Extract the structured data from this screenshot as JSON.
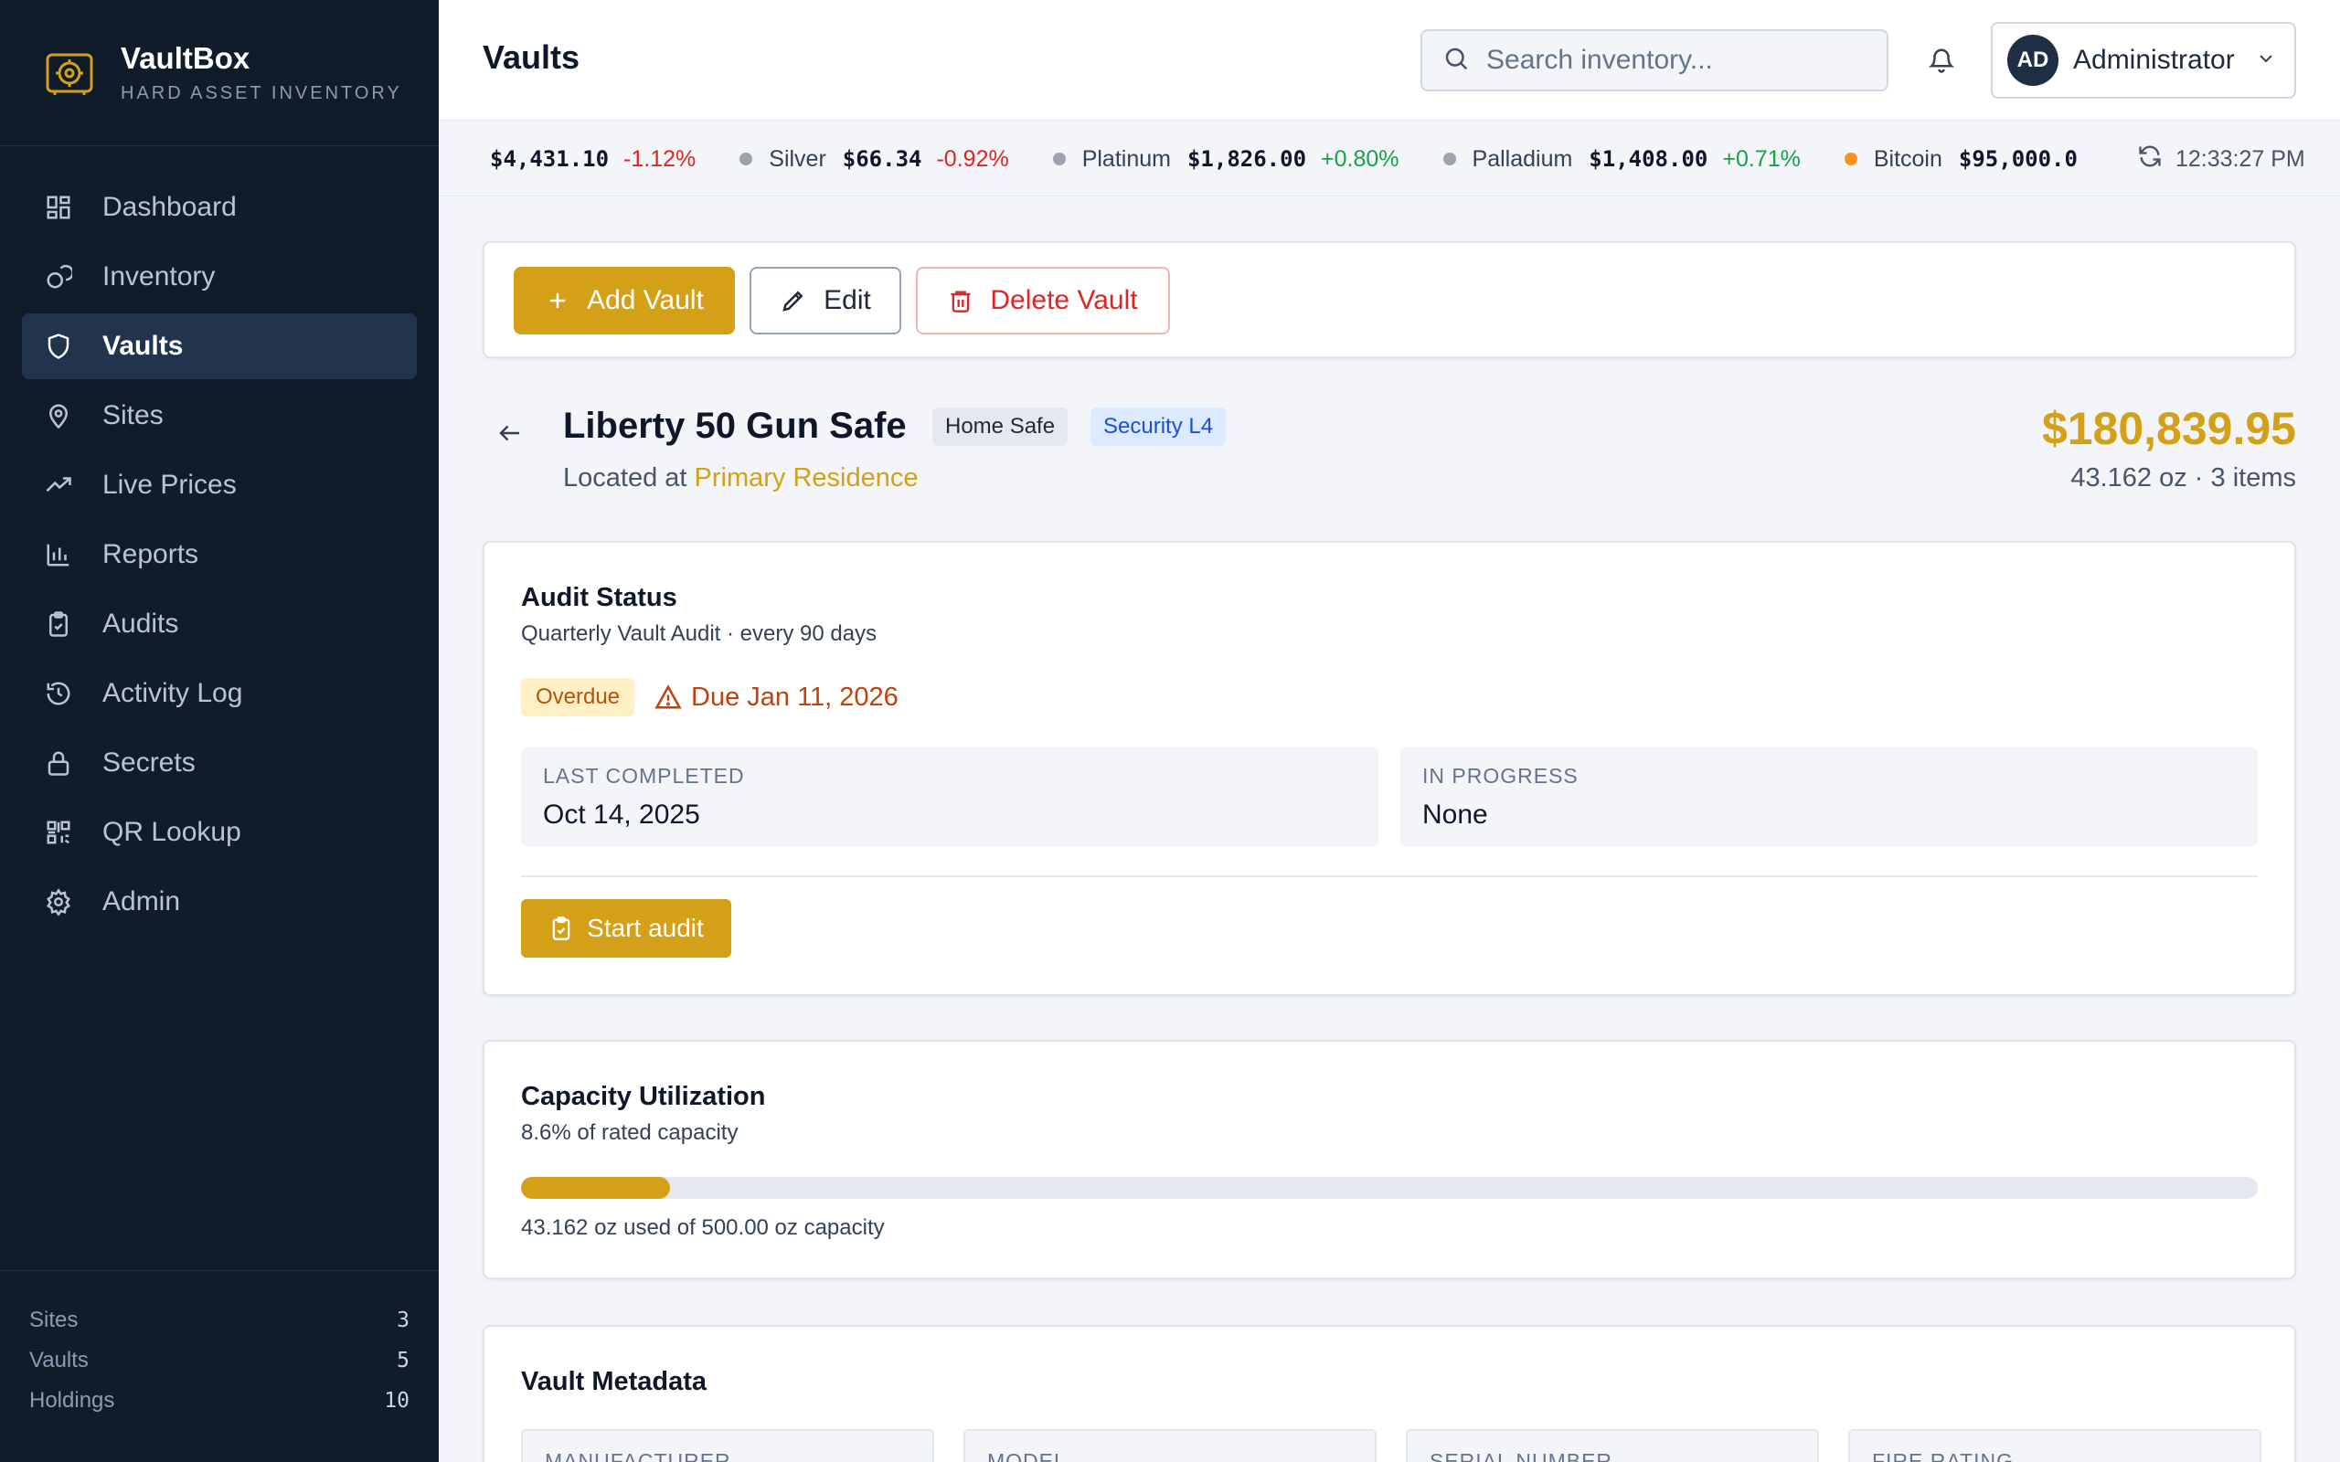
{
  "brand": {
    "name": "VaultBox",
    "subtitle": "HARD ASSET INVENTORY",
    "logo_icon": "vault-safe-icon"
  },
  "nav": [
    {
      "label": "Dashboard",
      "icon": "dashboard-grid-icon"
    },
    {
      "label": "Inventory",
      "icon": "coins-icon"
    },
    {
      "label": "Vaults",
      "icon": "shield-icon",
      "active": true
    },
    {
      "label": "Sites",
      "icon": "map-pin-icon"
    },
    {
      "label": "Live Prices",
      "icon": "trending-up-icon"
    },
    {
      "label": "Reports",
      "icon": "bar-chart-icon"
    },
    {
      "label": "Audits",
      "icon": "clipboard-check-icon"
    },
    {
      "label": "Activity Log",
      "icon": "history-icon"
    },
    {
      "label": "Secrets",
      "icon": "lock-icon"
    },
    {
      "label": "QR Lookup",
      "icon": "qr-code-icon"
    },
    {
      "label": "Admin",
      "icon": "gear-icon"
    }
  ],
  "sidebar_stats": [
    {
      "label": "Sites",
      "value": "3"
    },
    {
      "label": "Vaults",
      "value": "5"
    },
    {
      "label": "Holdings",
      "value": "10"
    }
  ],
  "header": {
    "title": "Vaults",
    "search_placeholder": "Search inventory...",
    "user_initials": "AD",
    "user_name": "Administrator"
  },
  "ticker": {
    "items": [
      {
        "name": "",
        "price": "$4,431.10",
        "change": "-1.12%",
        "direction": "down",
        "dot_color": ""
      },
      {
        "name": "Silver",
        "price": "$66.34",
        "change": "-0.92%",
        "direction": "down",
        "dot_color": "#9ca3af"
      },
      {
        "name": "Platinum",
        "price": "$1,826.00",
        "change": "+0.80%",
        "direction": "up",
        "dot_color": "#9ca3af"
      },
      {
        "name": "Palladium",
        "price": "$1,408.00",
        "change": "+0.71%",
        "direction": "up",
        "dot_color": "#9ca3af"
      },
      {
        "name": "Bitcoin",
        "price": "$95,000.0",
        "change": "",
        "direction": "",
        "dot_color": "#f7931a"
      }
    ],
    "time": "12:33:27 PM"
  },
  "actions": {
    "add": "Add Vault",
    "edit": "Edit",
    "delete": "Delete Vault"
  },
  "vault": {
    "name": "Liberty 50 Gun Safe",
    "type_tag": "Home Safe",
    "security_tag": "Security L4",
    "located_prefix": "Located at",
    "location": "Primary Residence",
    "total_value": "$180,839.95",
    "summary": "43.162 oz · 3 items"
  },
  "audit": {
    "title": "Audit Status",
    "subtitle": "Quarterly Vault Audit · every 90 days",
    "status_badge": "Overdue",
    "due_text": "Due Jan 11, 2026",
    "last_completed_label": "LAST COMPLETED",
    "last_completed_value": "Oct 14, 2025",
    "in_progress_label": "IN PROGRESS",
    "in_progress_value": "None",
    "start_button": "Start audit"
  },
  "capacity": {
    "title": "Capacity Utilization",
    "subtitle": "8.6% of rated capacity",
    "fraction": 0.086,
    "detail": "43.162 oz used of 500.00 oz capacity"
  },
  "metadata": {
    "title": "Vault Metadata",
    "fields": [
      "MANUFACTURER",
      "MODEL",
      "SERIAL NUMBER",
      "FIRE RATING"
    ]
  },
  "colors": {
    "accent": "#d4a017",
    "sidebar_bg": "#111c2b",
    "danger": "#dc2626",
    "success": "#16a34a"
  }
}
